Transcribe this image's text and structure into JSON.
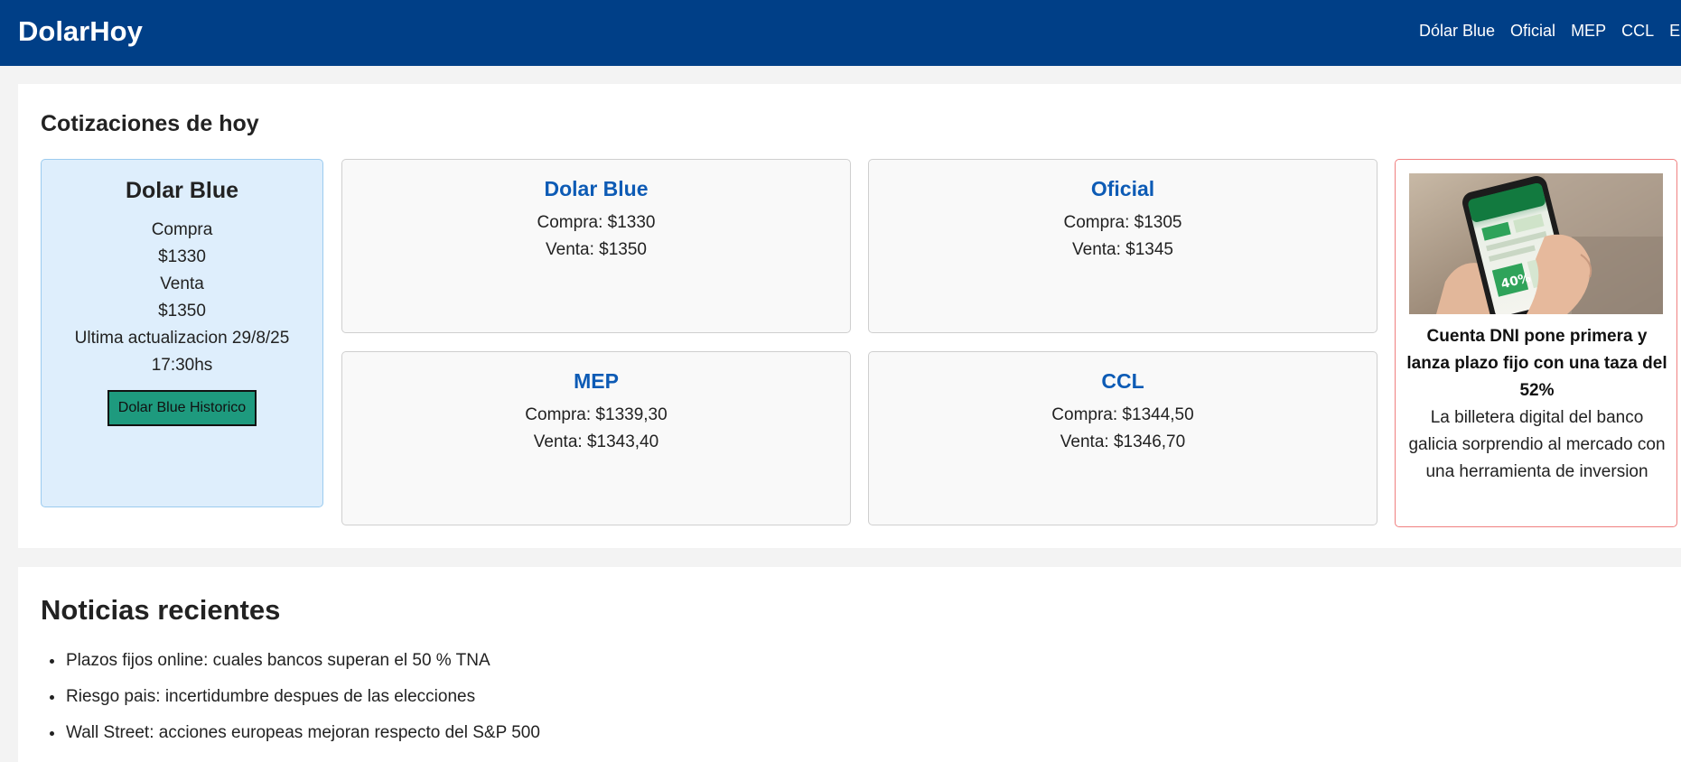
{
  "header": {
    "brand": "DolarHoy",
    "nav": [
      "Dólar Blue",
      "Oficial",
      "MEP",
      "CCL",
      "Eu"
    ]
  },
  "quotes": {
    "title": "Cotizaciones de hoy",
    "featured": {
      "title": "Dolar Blue",
      "compra_label": "Compra",
      "compra_value": "$1330",
      "venta_label": "Venta",
      "venta_value": "$1350",
      "updated_line1": "Ultima actualizacion 29/8/25",
      "updated_line2": "17:30hs",
      "button": "Dolar Blue Historico"
    },
    "cards": [
      {
        "name": "Dolar Blue",
        "compra": "Compra: $1330",
        "venta": "Venta: $1350"
      },
      {
        "name": "Oficial",
        "compra": "Compra: $1305",
        "venta": "Venta: $1345"
      },
      {
        "name": "MEP",
        "compra": "Compra: $1339,30",
        "venta": "Venta: $1343,40"
      },
      {
        "name": "CCL",
        "compra": "Compra: $1344,50",
        "venta": "Venta: $1346,70"
      }
    ],
    "promo": {
      "title": "Cuenta DNI pone primera y lanza plazo fijo con una taza del 52%",
      "description": "La billetera digital del banco galicia sorprendio al mercado con una herramienta de inversion",
      "image": "hands-holding-phone-image"
    }
  },
  "news": {
    "title": "Noticias recientes",
    "items": [
      "Plazos fijos online: cuales bancos superan el 50 % TNA",
      "Riesgo pais: incertidumbre despues de las elecciones",
      "Wall Street: acciones europeas mejoran respecto del S&P 500"
    ]
  },
  "colors": {
    "header_bg": "#003f87",
    "card_title": "#0d5bb5",
    "featured_bg": "#deeefc",
    "button_bg": "#1e9a7e",
    "promo_border": "#f08080"
  }
}
